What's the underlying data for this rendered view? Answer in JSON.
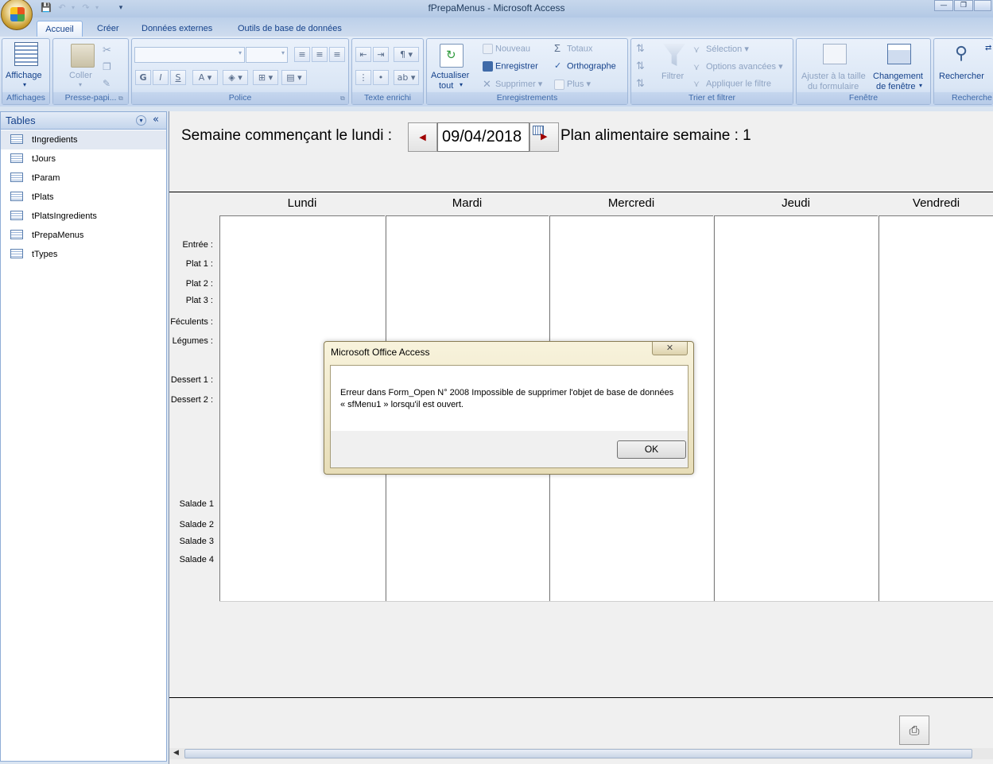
{
  "window": {
    "title": "fPrepaMenus - Microsoft Access",
    "minimize": "—",
    "restore": "❐"
  },
  "tabs": [
    "Accueil",
    "Créer",
    "Données externes",
    "Outils de base de données"
  ],
  "ribbon": {
    "affichage": {
      "label": "Affichage",
      "group": "Affichages"
    },
    "presse": {
      "coller": "Coller",
      "group": "Presse-papi..."
    },
    "police": {
      "group": "Police",
      "bold": "G",
      "italic": "I",
      "underline": "S"
    },
    "texte": {
      "group": "Texte enrichi"
    },
    "enregistrements": {
      "actualiser": "Actualiser",
      "actualiser2": "tout",
      "nouveau": "Nouveau",
      "enregistrer": "Enregistrer",
      "supprimer": "Supprimer",
      "totaux": "Totaux",
      "orthographe": "Orthographe",
      "plus": "Plus",
      "group": "Enregistrements"
    },
    "trier": {
      "filtrer": "Filtrer",
      "selection": "Sélection",
      "options": "Options avancées",
      "appliquer": "Appliquer le filtre",
      "group": "Trier et filtrer"
    },
    "fenetre": {
      "ajuster1": "Ajuster à la taille",
      "ajuster2": "du formulaire",
      "changement1": "Changement",
      "changement2": "de fenêtre",
      "group": "Fenêtre"
    },
    "recherche": {
      "rechercher": "Rechercher",
      "group": "Recherche"
    }
  },
  "nav": {
    "title": "Tables",
    "items": [
      "tIngredients",
      "tJours",
      "tParam",
      "tPlats",
      "tPlatsIngredients",
      "tPrepaMenus",
      "tTypes"
    ],
    "selected_index": 0
  },
  "form": {
    "week_label": "Semaine commençant le lundi :",
    "date_value": "09/04/2018",
    "plan_label": "Plan alimentaire semaine : 1",
    "days": [
      "Lundi",
      "Mardi",
      "Mercredi",
      "Jeudi",
      "Vendredi"
    ],
    "row_labels": {
      "entree": "Entrée :",
      "plat1": "Plat 1 :",
      "plat2": "Plat 2 :",
      "plat3": "Plat 3 :",
      "feculents": "Féculents :",
      "legumes": "Légumes :",
      "dessert1": "Dessert 1 :",
      "dessert2": "Dessert 2 :",
      "salade1": "Salade 1",
      "salade2": "Salade 2",
      "salade3": "Salade 3",
      "salade4": "Salade 4"
    }
  },
  "dialog": {
    "title": "Microsoft Office Access",
    "message": "Erreur dans Form_Open N° 2008 Impossible de supprimer l'objet de base de données « sfMenu1 » lorsqu'il est ouvert.",
    "ok": "OK"
  }
}
